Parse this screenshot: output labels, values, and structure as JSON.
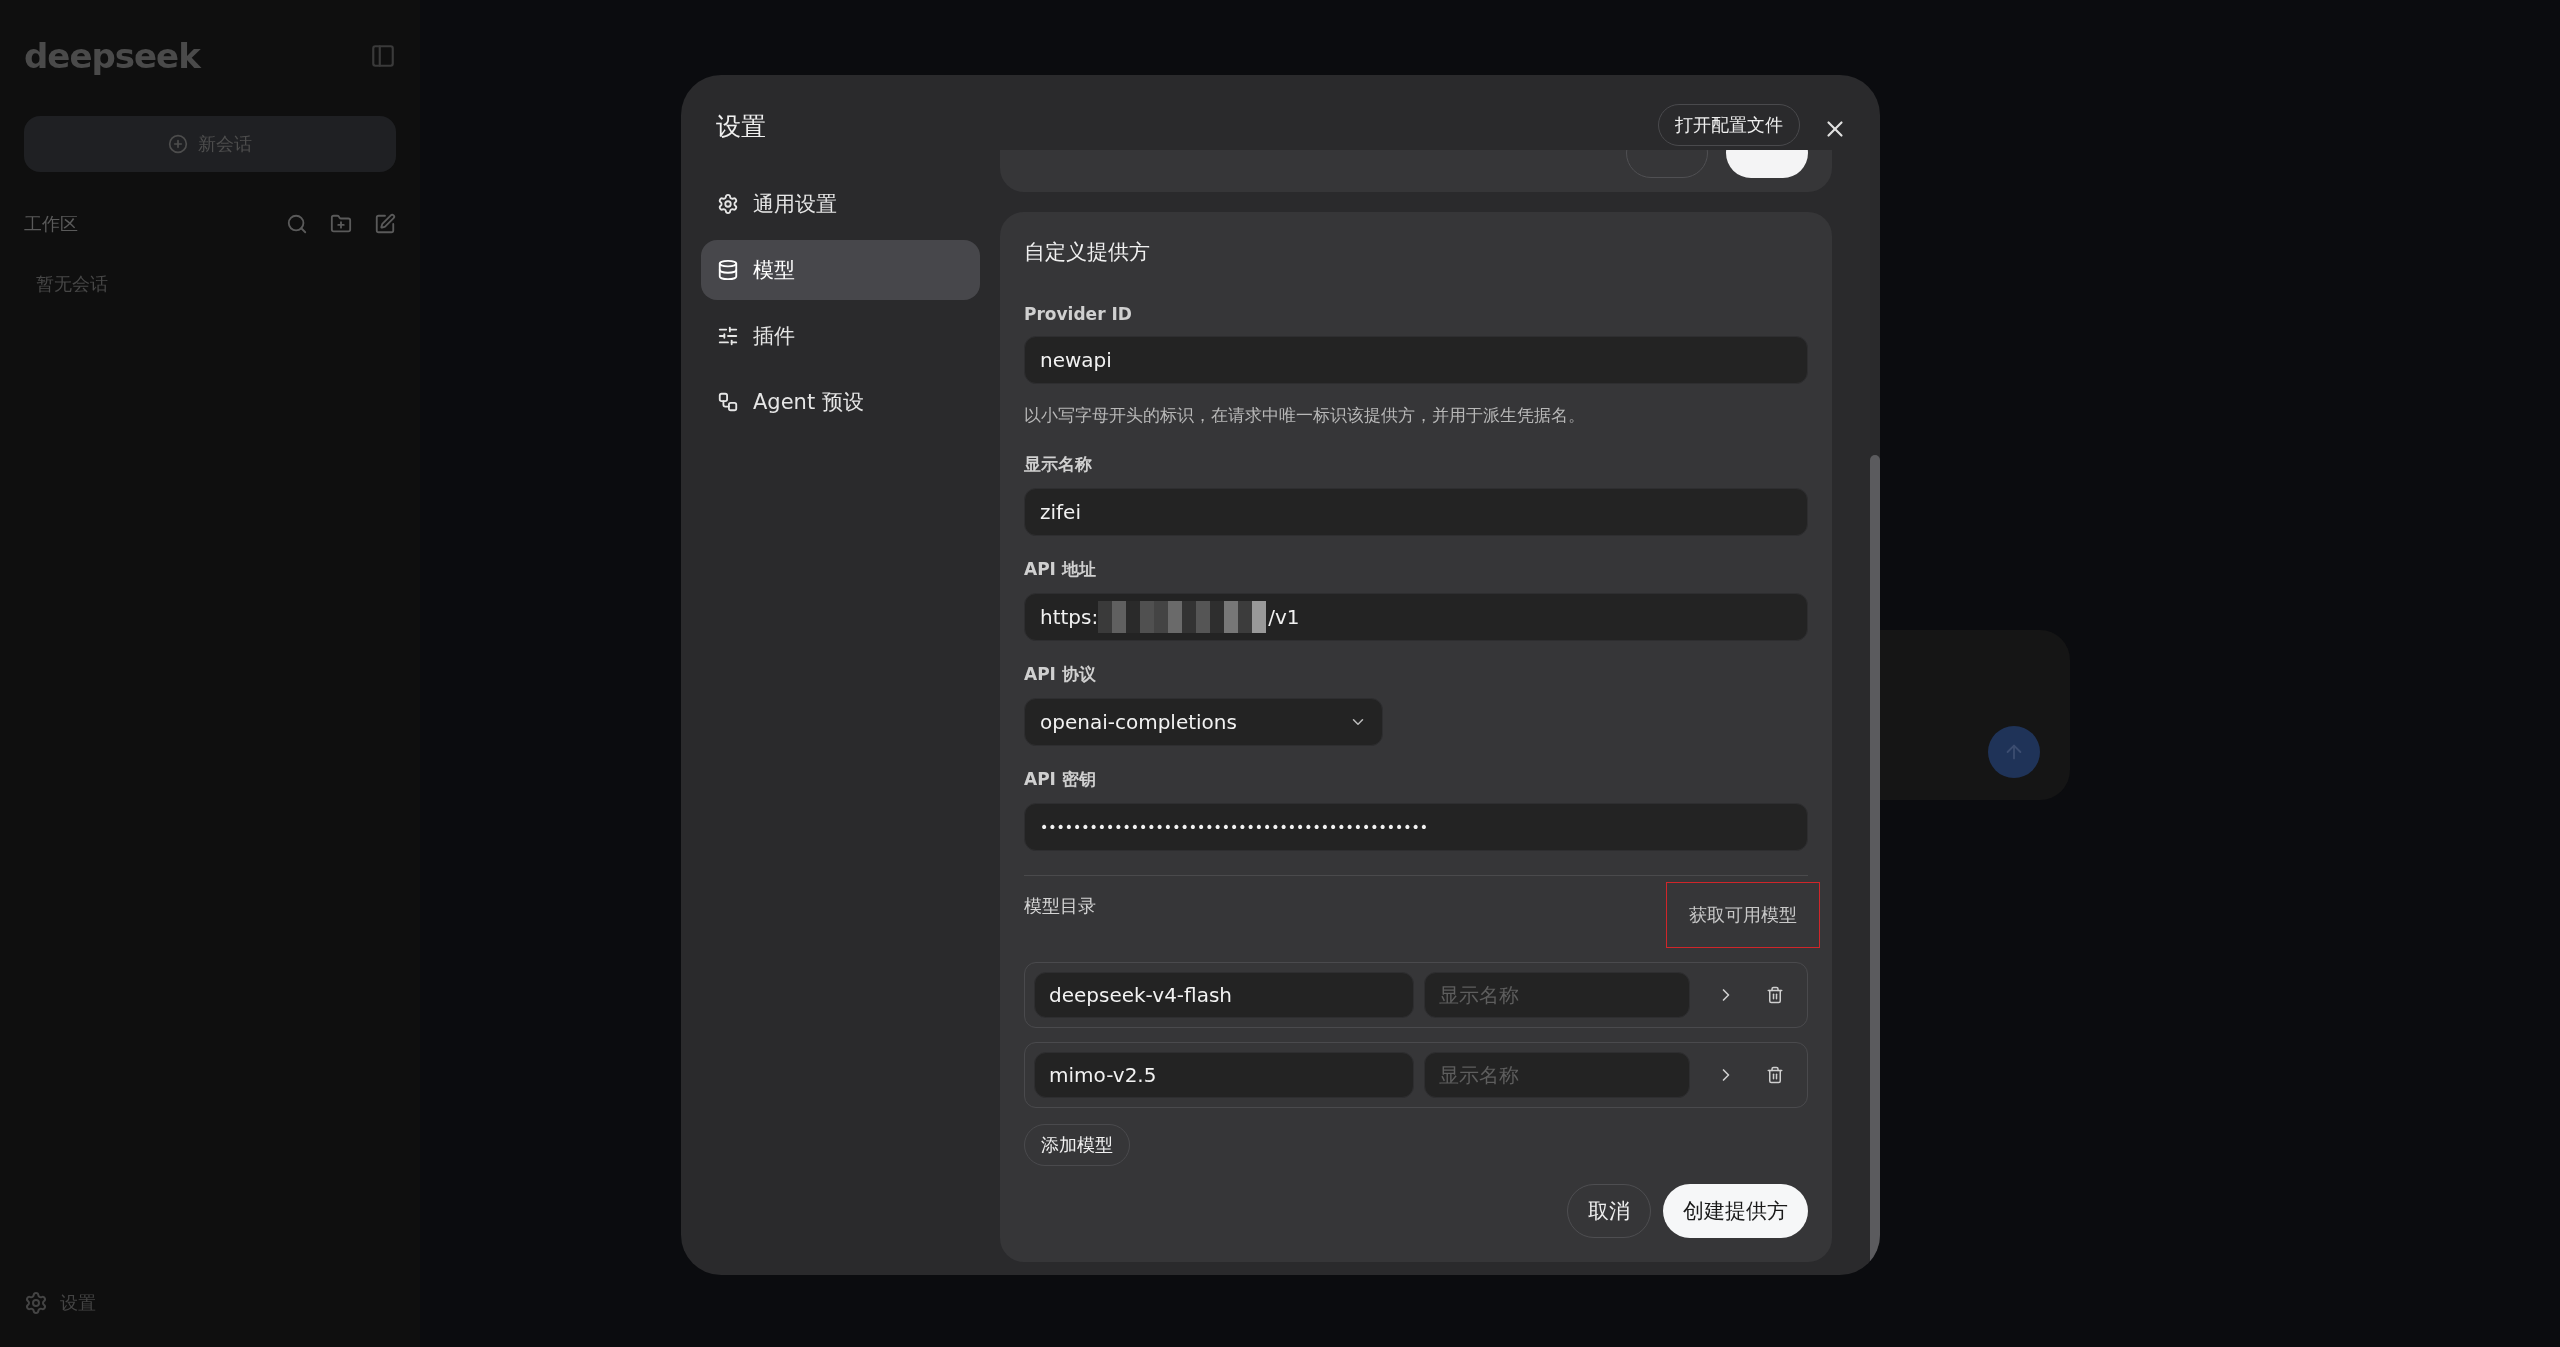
{
  "background": {
    "logo": "deepseek",
    "new_chat": "新会话",
    "workspace_label": "工作区",
    "empty_text": "暂无会话",
    "settings_label": "设置"
  },
  "settings": {
    "title": "设置",
    "open_config_button": "打开配置文件",
    "nav": [
      {
        "label": "通用设置",
        "selected": false
      },
      {
        "label": "模型",
        "selected": true
      },
      {
        "label": "插件",
        "selected": false
      },
      {
        "label": "Agent 预设",
        "selected": false
      }
    ],
    "provider_form": {
      "title": "自定义提供方",
      "provider_id": {
        "label": "Provider ID",
        "value": "newapi",
        "help": "以小写字母开头的标识，在请求中唯一标识该提供方，并用于派生凭据名。"
      },
      "display_name": {
        "label": "显示名称",
        "value": "zifei"
      },
      "api_url": {
        "label": "API 地址",
        "value_start": "https:",
        "value_end": "/v1"
      },
      "api_protocol": {
        "label": "API 协议",
        "value": "openai-completions"
      },
      "api_key": {
        "label": "API 密钥",
        "value": "•••••••••••••••••••••••••••••••••••••••••••••••"
      },
      "model_catalog": {
        "label": "模型目录",
        "fetch_button": "获取可用模型",
        "fetch_highlighted": true,
        "models": [
          {
            "id": "deepseek-v4-flash",
            "display_placeholder": "显示名称"
          },
          {
            "id": "mimo-v2.5",
            "display_placeholder": "显示名称"
          }
        ],
        "add_button": "添加模型"
      },
      "cancel_button": "取消",
      "create_button": "创建提供方"
    }
  }
}
